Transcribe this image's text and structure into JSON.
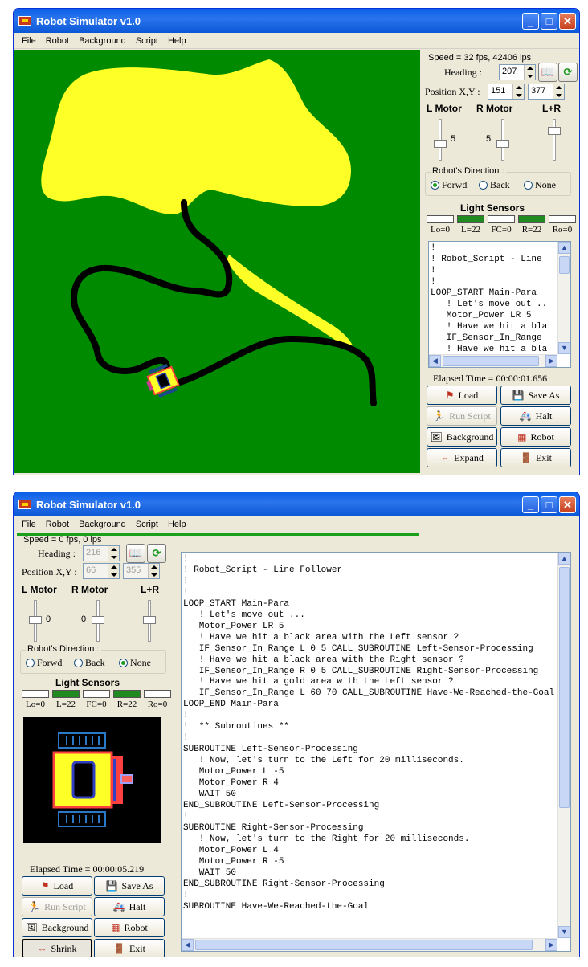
{
  "window_title": "Robot Simulator v1.0",
  "title_buttons": {
    "minimize": "_",
    "maximize": "□",
    "close": "✕"
  },
  "menu": [
    "File",
    "Robot",
    "Background",
    "Script",
    "Help"
  ],
  "top": {
    "speed": "Speed = 32 fps, 42406 lps",
    "heading_label": "Heading :",
    "heading_value": "207",
    "position_label": "Position X,Y :",
    "pos_x": "151",
    "pos_y": "377",
    "lmotor_label": "L Motor",
    "rmotor_label": "R Motor",
    "lr_label": "L+R",
    "lmotor_value": "5",
    "rmotor_value": "5",
    "direction_label": "Robot's Direction :",
    "dir_forward": "Forwd",
    "dir_back": "Back",
    "dir_none": "None",
    "light_label": "Light Sensors",
    "sensors": [
      "Lo=0",
      "L=22",
      "FC=0",
      "R=22",
      "Ro=0"
    ],
    "script_lines": "!\n! Robot_Script - Line\n!\n!\nLOOP_START Main-Para\n   ! Let's move out ..\n   Motor_Power LR 5\n   ! Have we hit a bla\n   IF_Sensor_In_Range\n   ! Have we hit a bla",
    "elapsed": "Elapsed Time = 00:00:01.656",
    "buttons": {
      "load": "Load",
      "save_as": "Save As",
      "run_script": "Run Script",
      "halt": "Halt",
      "background": "Background",
      "robot": "Robot",
      "expand": "Expand",
      "exit": "Exit"
    }
  },
  "bottom": {
    "speed": "Speed = 0 fps, 0 lps",
    "heading_label": "Heading :",
    "heading_value": "216",
    "position_label": "Position X,Y :",
    "pos_x": "66",
    "pos_y": "355",
    "lmotor_label": "L Motor",
    "rmotor_label": "R Motor",
    "lr_label": "L+R",
    "lmotor_value": "0",
    "rmotor_value": "0",
    "direction_label": "Robot's Direction :",
    "dir_forward": "Forwd",
    "dir_back": "Back",
    "dir_none": "None",
    "light_label": "Light Sensors",
    "sensors": [
      "Lo=0",
      "L=22",
      "FC=0",
      "R=22",
      "Ro=0"
    ],
    "script_lines": "!\n! Robot_Script - Line Follower\n!\n!\nLOOP_START Main-Para\n   ! Let's move out ...\n   Motor_Power LR 5\n   ! Have we hit a black area with the Left sensor ?\n   IF_Sensor_In_Range L 0 5 CALL_SUBROUTINE Left-Sensor-Processing\n   ! Have we hit a black area with the Right sensor ?\n   IF_Sensor_In_Range R 0 5 CALL_SUBROUTINE Right-Sensor-Processing\n   ! Have we hit a gold area with the Left sensor ?\n   IF_Sensor_In_Range L 60 70 CALL_SUBROUTINE Have-We-Reached-the-Goal\nLOOP_END Main-Para\n!\n!  ** Subroutines **\n!\nSUBROUTINE Left-Sensor-Processing\n   ! Now, let's turn to the Left for 20 milliseconds.\n   Motor_Power L -5\n   Motor_Power R 4\n   WAIT 50\nEND_SUBROUTINE Left-Sensor-Processing\n!\nSUBROUTINE Right-Sensor-Processing\n   ! Now, let's turn to the Right for 20 milliseconds.\n   Motor_Power L 4\n   Motor_Power R -5\n   WAIT 50\nEND_SUBROUTINE Right-Sensor-Processing\n!\nSUBROUTINE Have-We-Reached-the-Goal",
    "elapsed": "Elapsed Time = 00:00:05.219",
    "buttons": {
      "load": "Load",
      "save_as": "Save As",
      "run_script": "Run Script",
      "halt": "Halt",
      "background": "Background",
      "robot": "Robot",
      "shrink": "Shrink",
      "exit": "Exit"
    }
  },
  "colors": {
    "field": "#008a00",
    "yellow_area": "#ffff28",
    "black_line": "#000000",
    "sensor_on": "#1f8a1f"
  }
}
